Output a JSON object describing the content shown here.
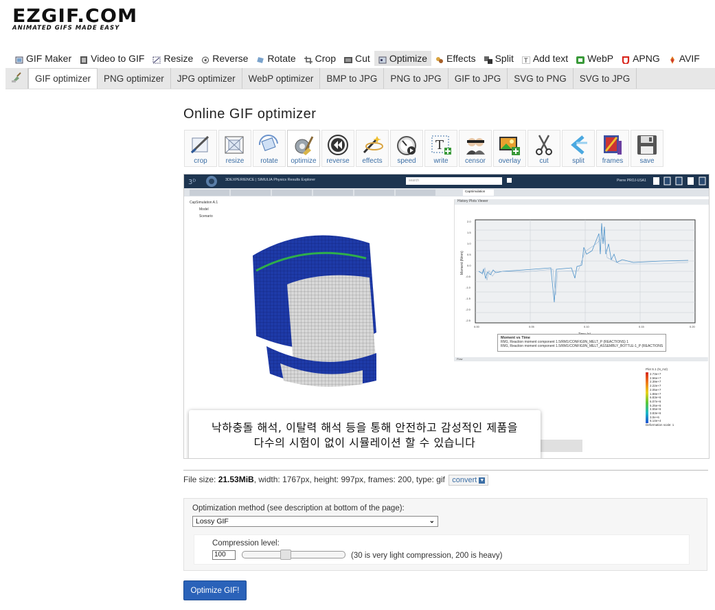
{
  "logo": {
    "name": "EZGIF.COM",
    "tagline": "ANIMATED GIFS MADE EASY"
  },
  "main_nav": [
    {
      "label": "GIF Maker",
      "icon": "gif-maker-icon"
    },
    {
      "label": "Video to GIF",
      "icon": "video-icon"
    },
    {
      "label": "Resize",
      "icon": "resize-icon"
    },
    {
      "label": "Reverse",
      "icon": "reverse-icon"
    },
    {
      "label": "Rotate",
      "icon": "rotate-icon"
    },
    {
      "label": "Crop",
      "icon": "crop-icon"
    },
    {
      "label": "Cut",
      "icon": "cut-icon"
    },
    {
      "label": "Optimize",
      "icon": "optimize-icon",
      "active": true
    },
    {
      "label": "Effects",
      "icon": "effects-icon"
    },
    {
      "label": "Split",
      "icon": "split-icon"
    },
    {
      "label": "Add text",
      "icon": "text-icon"
    },
    {
      "label": "WebP",
      "icon": "webp-icon"
    },
    {
      "label": "APNG",
      "icon": "apng-icon"
    },
    {
      "label": "AVIF",
      "icon": "avif-icon"
    }
  ],
  "sub_nav": [
    "GIF optimizer",
    "PNG optimizer",
    "JPG optimizer",
    "WebP optimizer",
    "BMP to JPG",
    "PNG to JPG",
    "GIF to JPG",
    "SVG to PNG",
    "SVG to JPG"
  ],
  "page_title": "Online GIF optimizer",
  "tools": [
    "crop",
    "resize",
    "rotate",
    "optimize",
    "reverse",
    "effects",
    "speed",
    "write",
    "censor",
    "overlay",
    "cut",
    "split",
    "frames",
    "save"
  ],
  "preview": {
    "app_header": "3DEXPERIENCE | SIMULIA Physics Results Explorer",
    "search_placeholder": "search",
    "user": "Pierre PROJ-USA1",
    "tab_active": "CapSimulation",
    "tree": [
      "CapSimulation A.1",
      "Model",
      "Scenario",
      "Result"
    ],
    "plot_header": "History Plots Viewer",
    "plot_title": "Moment vs Time",
    "plot_xlabel": "Time (s)",
    "plot_ylabel": "Moment (Nmm)",
    "plot_yticks": [
      "2.0",
      "1.5",
      "1.0",
      "0.5",
      "0.0",
      "-0.5",
      "-1.0",
      "-1.5",
      "-2.0",
      "-2.5"
    ],
    "plot_xticks": [
      "0.00",
      "0.05",
      "0.10",
      "0.15",
      "0.20"
    ],
    "legend_items": [
      "RM1, Reaction moment component 1.5/RM1/CONFIG9N_MELT_P  (REACTIONS) 1",
      "RM1, Reaction moment component 1.5/RM1/CONFIG9N_MELT_ASSEMBLY_BOTTLE-1_P  (REACTIONS) 5999"
    ],
    "flow_label": "Flow",
    "scale_title": "Plot S.1 (N_m2)",
    "scale_values": [
      "2.73e+7",
      "2.56e+7",
      "2.39e+7",
      "2.22e+7",
      "2.05e+7",
      "1.88e+7",
      "6.83e+6",
      "6.07e+6",
      "5.25e+6",
      "4.55e+6",
      "3.83e+6",
      "3.0e+6",
      "6.14e+4"
    ],
    "scale_footer": "Deformation scale: 1",
    "caption_line1": "낙하충돌 해석, 이탈력 해석 등을 통해 안전하고 감성적인 제품을",
    "caption_line2": "다수의 시험이 없이 시뮬레이션 할 수 있습니다"
  },
  "file_info": {
    "label_size": "File size: ",
    "size": "21.53MiB",
    "rest": ", width: 1767px, height: 997px, frames: 200, type: gif",
    "convert": "convert"
  },
  "optimization": {
    "method_label": "Optimization method (see description at bottom of the page):",
    "method_value": "Lossy GIF",
    "compression_label": "Compression level:",
    "compression_value": "100",
    "compression_min": 30,
    "compression_max": 200,
    "hint": "(30 is very light compression, 200 is heavy)",
    "submit": "Optimize GIF!"
  },
  "colors": {
    "accent": "#2a62b9",
    "link": "#3b6ea5",
    "active_tab": "#e4e4e4"
  }
}
